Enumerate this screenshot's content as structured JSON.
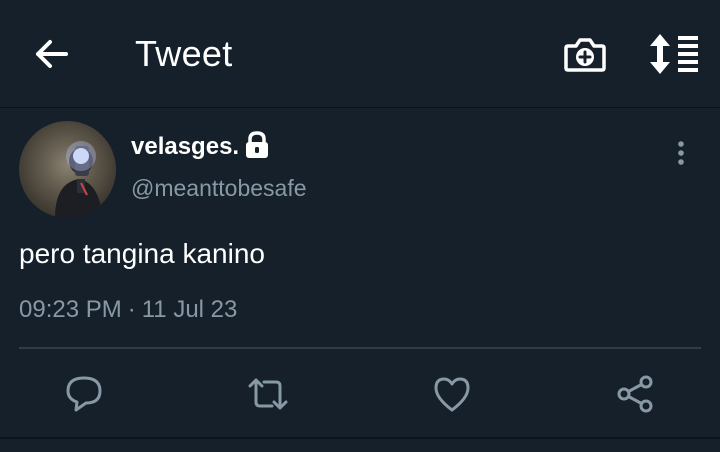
{
  "header": {
    "title": "Tweet",
    "back_icon": "arrow-left-icon",
    "camera_icon": "camera-plus-icon",
    "sort_icon": "sort-list-icon"
  },
  "tweet": {
    "display_name": "velasges.",
    "protected_icon": "lock-icon",
    "handle": "@meanttobesafe",
    "text": "pero tangina kanino",
    "time": "09:23 PM",
    "separator": "·",
    "date": "11 Jul 23",
    "more_icon": "more-vertical-icon"
  },
  "actions": [
    {
      "name": "reply",
      "icon": "reply-icon"
    },
    {
      "name": "retweet",
      "icon": "retweet-icon"
    },
    {
      "name": "like",
      "icon": "heart-icon"
    },
    {
      "name": "share",
      "icon": "share-icon"
    }
  ],
  "colors": {
    "background": "#15202b",
    "primary_text": "#ffffff",
    "secondary_text": "#8899a6",
    "divider": "#2f3c4a"
  }
}
